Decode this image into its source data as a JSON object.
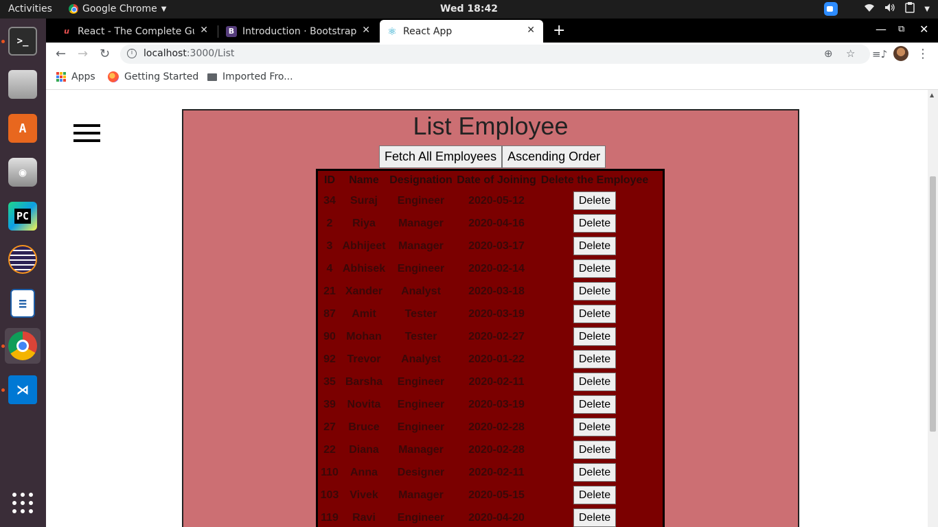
{
  "system": {
    "activities": "Activities",
    "app_name": "Google Chrome",
    "clock": "Wed 18:42"
  },
  "dock": {
    "items": [
      "terminal-icon",
      "files-icon",
      "software-icon",
      "camera-icon",
      "pycharm-icon",
      "eclipse-icon",
      "writer-icon",
      "chrome-icon",
      "vscode-icon",
      "show-apps-icon"
    ]
  },
  "browser": {
    "tabs": [
      {
        "label": "React - The Complete Guic",
        "active": false
      },
      {
        "label": "Introduction · Bootstrap v",
        "active": false
      },
      {
        "label": "React App",
        "active": true
      }
    ],
    "url_host": "localhost",
    "url_path": ":3000/List",
    "bookmarks": [
      {
        "label": "Apps"
      },
      {
        "label": "Getting Started"
      },
      {
        "label": "Imported Fro..."
      }
    ]
  },
  "page": {
    "title": "List Employee",
    "fetch_button": "Fetch All Employees",
    "sort_button": "Ascending Order",
    "columns": [
      "ID",
      "Name",
      "Designation",
      "Date of Joining",
      "Delete the Employee"
    ],
    "delete_label": "Delete",
    "rows": [
      [
        "34",
        "Suraj",
        "Engineer",
        "2020-05-12"
      ],
      [
        "2",
        "Riya",
        "Manager",
        "2020-04-16"
      ],
      [
        "3",
        "Abhijeet",
        "Manager",
        "2020-03-17"
      ],
      [
        "4",
        "Abhisek",
        "Engineer",
        "2020-02-14"
      ],
      [
        "21",
        "Xander",
        "Analyst",
        "2020-03-18"
      ],
      [
        "87",
        "Amit",
        "Tester",
        "2020-03-19"
      ],
      [
        "90",
        "Mohan",
        "Tester",
        "2020-02-27"
      ],
      [
        "92",
        "Trevor",
        "Analyst",
        "2020-01-22"
      ],
      [
        "35",
        "Barsha",
        "Engineer",
        "2020-02-11"
      ],
      [
        "39",
        "Novita",
        "Engineer",
        "2020-03-19"
      ],
      [
        "27",
        "Bruce",
        "Engineer",
        "2020-02-28"
      ],
      [
        "22",
        "Diana",
        "Manager",
        "2020-02-28"
      ],
      [
        "110",
        "Anna",
        "Designer",
        "2020-02-11"
      ],
      [
        "103",
        "Vivek",
        "Manager",
        "2020-05-15"
      ],
      [
        "119",
        "Ravi",
        "Engineer",
        "2020-04-20"
      ]
    ]
  },
  "colors": {
    "panel": "#cc6f73",
    "table_bg": "#7b0000"
  }
}
